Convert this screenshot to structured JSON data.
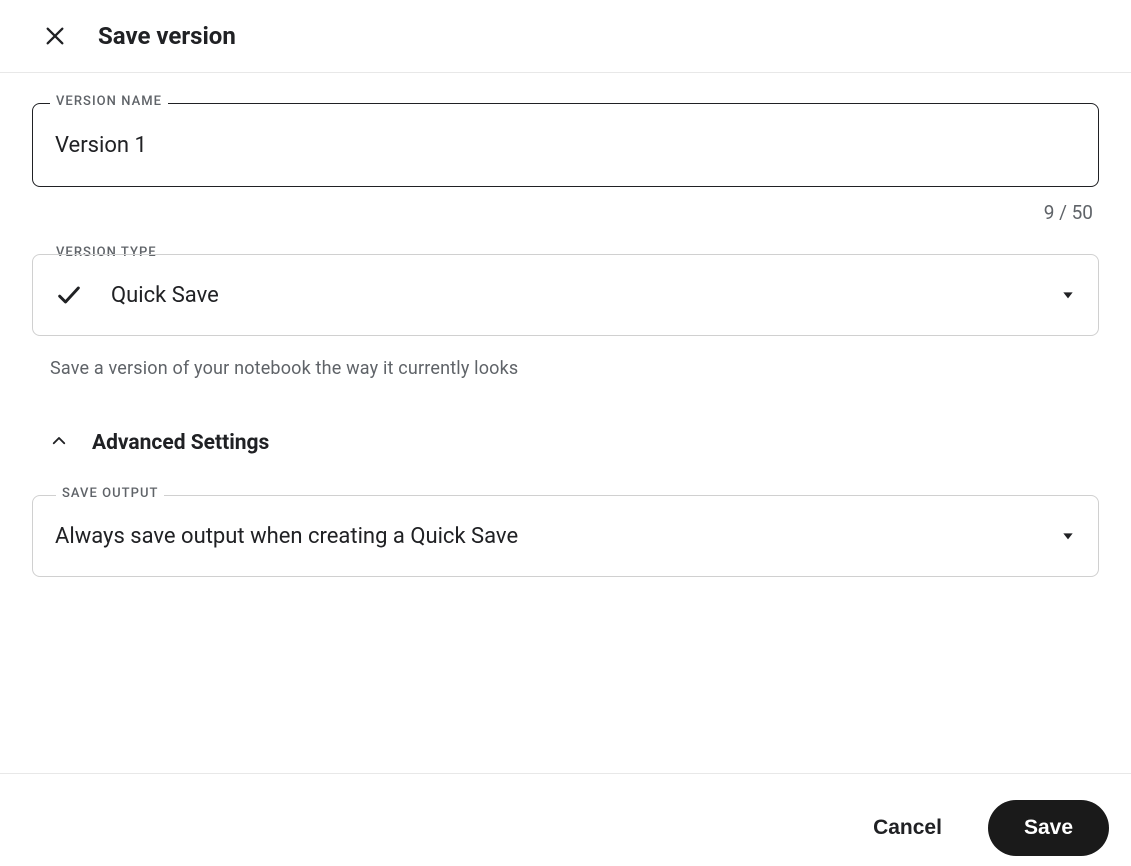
{
  "header": {
    "title": "Save version"
  },
  "version_name": {
    "label": "VERSION NAME",
    "value": "Version 1",
    "char_count": "9 / 50"
  },
  "version_type": {
    "label": "VERSION TYPE",
    "selected": "Quick Save",
    "helper": "Save a version of your notebook the way it currently looks"
  },
  "advanced": {
    "title": "Advanced Settings"
  },
  "save_output": {
    "label": "SAVE OUTPUT",
    "selected": "Always save output when creating a Quick Save"
  },
  "footer": {
    "cancel": "Cancel",
    "save": "Save"
  }
}
